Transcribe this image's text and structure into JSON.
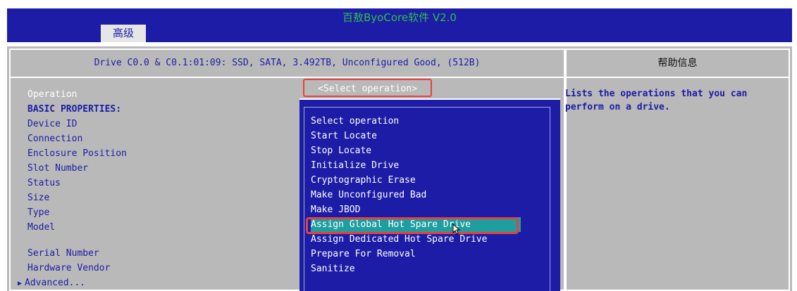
{
  "header": {
    "app_title": "百敖ByoCore软件 V2.0",
    "active_tab": "高级"
  },
  "panel": {
    "drive_header": "Drive C0.0 & C0.1:01:09: SSD, SATA, 3.492TB, Unconfigured Good, (512B)",
    "help_title": "帮助信息",
    "help_text": "Lists the operations that you can perform on a drive."
  },
  "fields": [
    {
      "label": "Operation"
    },
    {
      "label": "BASIC PROPERTIES:"
    },
    {
      "label": "Device ID"
    },
    {
      "label": "Connection"
    },
    {
      "label": "Enclosure Position"
    },
    {
      "label": "Slot Number"
    },
    {
      "label": "Status"
    },
    {
      "label": "Size"
    },
    {
      "label": "Type"
    },
    {
      "label": "Model"
    },
    {
      "label": "Serial Number"
    },
    {
      "label": "Hardware Vendor"
    },
    {
      "label": "Advanced..."
    }
  ],
  "operation": {
    "current_value": "<Select operation>",
    "options": [
      "Select operation",
      "Start Locate",
      "Stop Locate",
      "Initialize Drive",
      "Cryptographic Erase",
      "Make Unconfigured Bad",
      "Make JBOD",
      "Assign Global Hot Spare Drive",
      "Assign Dedicated Hot Spare Drive",
      "Prepare For Removal",
      "Sanitize"
    ],
    "highlighted_option": "Assign Global Hot Spare Drive"
  },
  "colors": {
    "bios_blue": "#1c1ca6",
    "bios_gray": "#b9b9b9",
    "highlight_teal": "#1f9ea0",
    "callout_red": "#e8403a",
    "title_green": "#2fbf4a"
  },
  "icons": {
    "advanced_expander": "triangle-right-icon",
    "mouse_cursor": "arrow-cursor-icon"
  }
}
